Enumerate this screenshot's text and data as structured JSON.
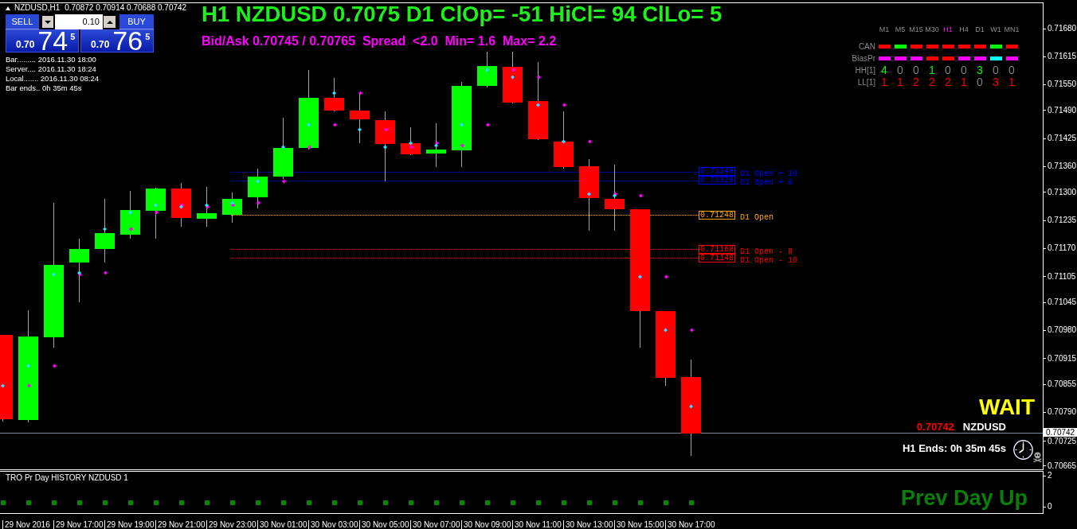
{
  "chart_header": {
    "symbol": "NZDUSD,H1",
    "ohlc": "0.70872 0.70914 0.70688 0.70742"
  },
  "trade_panel": {
    "sell": {
      "label": "SELL",
      "price_prefix": "0.70",
      "price_pips": "74",
      "price_fraction": "5"
    },
    "lot_size": "0.10",
    "buy": {
      "label": "BUY",
      "price_prefix": "0.70",
      "price_pips": "76",
      "price_fraction": "5"
    }
  },
  "info_lines": [
    "Bar......... 2016.11.30 18:00",
    "Server.... 2016.11.30 18:24",
    "Local....... 2016.11.30 08:24",
    "Bar ends.. 0h 35m 45s"
  ],
  "headline": "H1 NZDUSD 0.7075 D1 ClOp= -51 HiCl= 94 ClLo= 5",
  "quote_line": "Bid/Ask 0.70745 / 0.70765  Spread  <2.0  Min= 1.6  Max= 2.2",
  "timeframe_table": {
    "columns": [
      {
        "label": "M1",
        "selected": false
      },
      {
        "label": "M5",
        "selected": false
      },
      {
        "label": "M15",
        "selected": false
      },
      {
        "label": "M30",
        "selected": false
      },
      {
        "label": "H1",
        "selected": true
      },
      {
        "label": "H4",
        "selected": false
      },
      {
        "label": "D1",
        "selected": false
      },
      {
        "label": "W1",
        "selected": false
      },
      {
        "label": "MN1",
        "selected": false
      }
    ],
    "rows": [
      {
        "label": "CAN",
        "kind": "dash",
        "cells": [
          {
            "color": "#ff0000"
          },
          {
            "color": "#00ff00"
          },
          {
            "color": "#ff0000"
          },
          {
            "color": "#ff0000"
          },
          {
            "color": "#ff0000"
          },
          {
            "color": "#ff0000"
          },
          {
            "color": "#ff0000"
          },
          {
            "color": "#00ff00"
          },
          {
            "color": "#ff0000"
          }
        ]
      },
      {
        "label": "BiasPr",
        "kind": "dash",
        "cells": [
          {
            "color": "#ff00ff"
          },
          {
            "color": "#ff00ff"
          },
          {
            "color": "#ff00ff"
          },
          {
            "color": "#ff0000"
          },
          {
            "color": "#ff0000"
          },
          {
            "color": "#ff00ff"
          },
          {
            "color": "#ff00ff"
          },
          {
            "color": "#00ffff"
          },
          {
            "color": "#ff00ff"
          }
        ]
      },
      {
        "label": "HH[1]",
        "kind": "count",
        "cells": [
          {
            "text": "4",
            "color": "#00ff00"
          },
          {
            "text": "0",
            "color": "#808080"
          },
          {
            "text": "0",
            "color": "#808080"
          },
          {
            "text": "1",
            "color": "#00ff00"
          },
          {
            "text": "0",
            "color": "#808080"
          },
          {
            "text": "0",
            "color": "#808080"
          },
          {
            "text": "3",
            "color": "#00ff00"
          },
          {
            "text": "0",
            "color": "#808080"
          },
          {
            "text": "0",
            "color": "#808080"
          }
        ]
      },
      {
        "label": "LL[1]",
        "kind": "count",
        "cells": [
          {
            "text": "1",
            "color": "#ff0000"
          },
          {
            "text": "1",
            "color": "#ff0000"
          },
          {
            "text": "2",
            "color": "#ff0000"
          },
          {
            "text": "2",
            "color": "#ff0000"
          },
          {
            "text": "2",
            "color": "#ff0000"
          },
          {
            "text": "1",
            "color": "#ff0000"
          },
          {
            "text": "0",
            "color": "#808080"
          },
          {
            "text": "3",
            "color": "#ff0000"
          },
          {
            "text": "1",
            "color": "#ff0000"
          }
        ]
      }
    ]
  },
  "levels": [
    {
      "price": "0.71348",
      "label": "D1 Open + 10",
      "color": "#0000ff"
    },
    {
      "price": "0.71328",
      "label": "D1 Open + 8",
      "color": "#0000ff"
    },
    {
      "price": "0.71248",
      "label": "D1 Open",
      "color": "#ffa500"
    },
    {
      "price": "0.71168",
      "label": "D1 Open - 8",
      "color": "#ff0000"
    },
    {
      "price": "0.71148",
      "label": "D1 Open - 10",
      "color": "#ff0000"
    }
  ],
  "signal": {
    "text": "WAIT",
    "price": "0.70742",
    "symbol": "NZDUSD",
    "countdown": "H1 Ends: 0h 35m 45s"
  },
  "price_axis": {
    "ticks": [
      "0.71680",
      "0.71615",
      "0.71550",
      "0.71490",
      "0.71425",
      "0.71360",
      "0.71300",
      "0.71235",
      "0.71170",
      "0.71105",
      "0.71045",
      "0.70980",
      "0.70915",
      "0.70855",
      "0.70790",
      "0.70725",
      "0.70665"
    ],
    "current": "0.70742"
  },
  "indicator": {
    "title": "TRO Pr Day HISTORY NZDUSD 1",
    "message": "Prev Day Up",
    "scale": [
      "2",
      "0"
    ]
  },
  "time_axis": [
    "29 Nov 2016",
    "29 Nov 17:00",
    "29 Nov 19:00",
    "29 Nov 21:00",
    "29 Nov 23:00",
    "30 Nov 01:00",
    "30 Nov 03:00",
    "30 Nov 05:00",
    "30 Nov 07:00",
    "30 Nov 09:00",
    "30 Nov 11:00",
    "30 Nov 13:00",
    "30 Nov 15:00",
    "30 Nov 17:00"
  ]
}
